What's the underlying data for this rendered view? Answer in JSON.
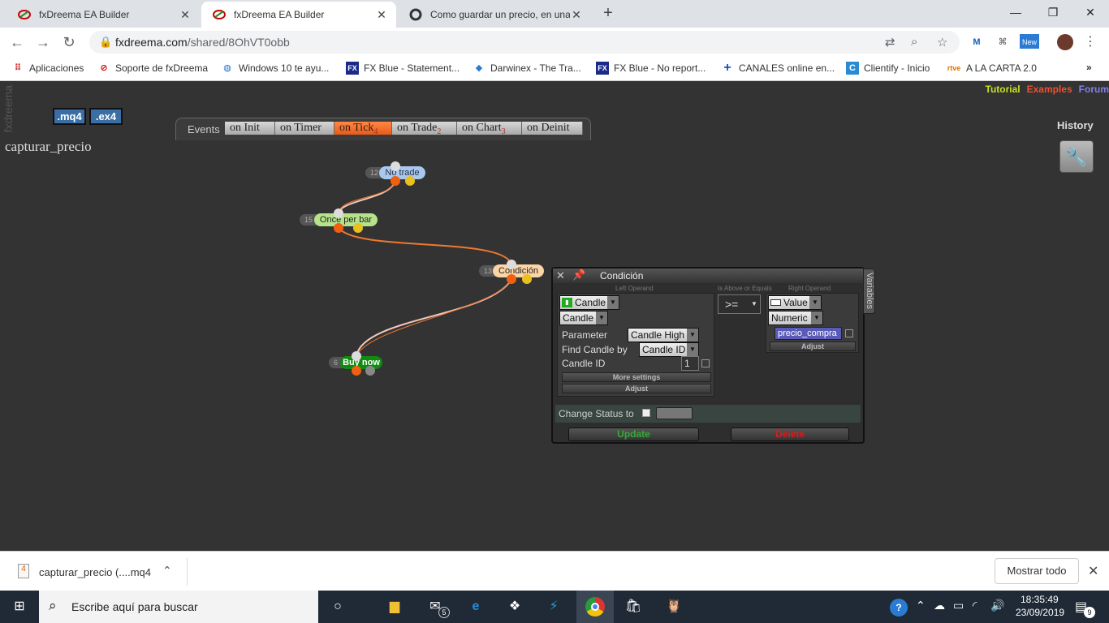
{
  "browser": {
    "tabs": [
      {
        "title": "fxDreema EA Builder",
        "active": false
      },
      {
        "title": "fxDreema EA Builder",
        "active": true
      },
      {
        "title": "Como guardar un precio, en una",
        "active": false
      }
    ],
    "url_domain": "fxdreema.com",
    "url_path": "/shared/8OhVT0obb",
    "bookmarks": [
      "Aplicaciones",
      "Soporte de fxDreema",
      "Windows 10 te ayu...",
      "FX Blue - Statement...",
      "Darwinex - The Tra...",
      "FX Blue - No report...",
      "CANALES online en...",
      "Clientify - Inicio",
      "A LA CARTA 2.0"
    ],
    "bookmark_icons": [
      "FX",
      "FX",
      "rtve"
    ],
    "more": "»",
    "ext_new": "New"
  },
  "app": {
    "side_logo": "fxdreema",
    "btn_mq4": ".mq4",
    "btn_ex4": ".ex4",
    "links": {
      "tutorial": "Tutorial",
      "examples": "Examples",
      "forum": "Forum"
    },
    "history": "History",
    "project_title": "capturar_precio",
    "events_label": "Events",
    "event_tabs": [
      {
        "label": "on Init",
        "badge": ""
      },
      {
        "label": "on Timer",
        "badge": ""
      },
      {
        "label": "on Tick",
        "badge": "4"
      },
      {
        "label": "on Trade",
        "badge": "2"
      },
      {
        "label": "on Chart",
        "badge": "3"
      },
      {
        "label": "on Deinit",
        "badge": ""
      }
    ],
    "blocks": [
      {
        "id": "12",
        "label": "No trade"
      },
      {
        "id": "15",
        "label": "Once per bar"
      },
      {
        "id": "13",
        "label": "Condición"
      },
      {
        "id": "6",
        "label": "Buy now"
      }
    ],
    "colors": {
      "no_trade": "#a9c8f0",
      "once_per_bar": "#b6e38a",
      "condicion": "#fbd5a5",
      "buy_now": "#118a11",
      "wire_orange": "#f07830",
      "wire_pink": "#f0c8c0"
    }
  },
  "dialog": {
    "title": "Condición",
    "variables_tab": "Variables",
    "left_caption": "Left Operand",
    "op_caption": "Is Above or Equals",
    "right_caption": "Right Operand",
    "left_type": "Candle",
    "left_sub": "Candle",
    "rows": [
      {
        "label": "Parameter",
        "value": "Candle High"
      },
      {
        "label": "Find Candle by",
        "value": "Candle ID"
      },
      {
        "label": "Candle ID",
        "value": "1"
      }
    ],
    "more_settings": "More settings",
    "adjust": "Adjust",
    "operator": ">=",
    "right_type": "Value",
    "right_sub": "Numeric",
    "right_value": "precio_compra",
    "right_adjust": "Adjust",
    "change_status": "Change Status to",
    "update": "Update",
    "delete": "Delete"
  },
  "download": {
    "file": "capturar_precio (....mq4",
    "show_all": "Mostrar todo"
  },
  "taskbar": {
    "search_placeholder": "Escribe aquí para buscar",
    "mail_badge": "5",
    "time": "18:35:49",
    "date": "23/09/2019",
    "notif_count": "9"
  }
}
